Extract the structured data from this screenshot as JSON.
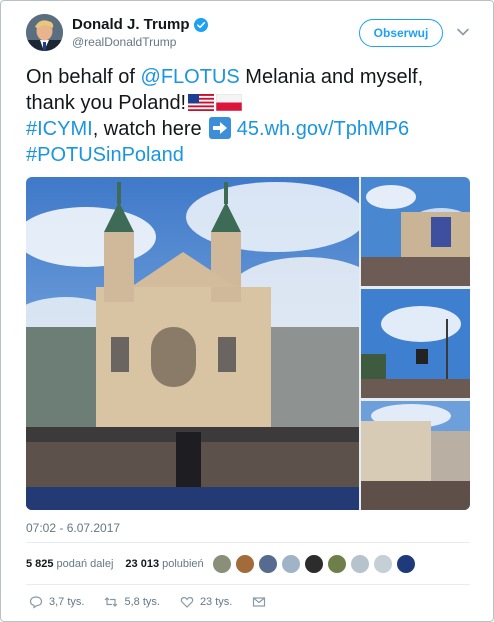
{
  "author": {
    "name": "Donald J. Trump",
    "handle": "@realDonaldTrump"
  },
  "follow_button": "Obserwuj",
  "tweet": {
    "line1_pre": "On behalf of ",
    "mention": "@FLOTUS",
    "line1_post": " Melania and myself,",
    "line2": "thank you Poland!",
    "hashtag1": "#ICYMI",
    "line3_mid": ", watch here",
    "link": "45.wh.gov/TphMP6",
    "hashtag2": "#POTUSinPoland"
  },
  "timestamp": "07:02 - 6.07.2017",
  "stats": {
    "retweets_count": "5 825",
    "retweets_label": "podań dalej",
    "likes_count": "23 013",
    "likes_label": "polubień"
  },
  "actions": {
    "replies": "3,7 tys.",
    "retweets": "5,8 tys.",
    "likes": "23 tys."
  },
  "colors": {
    "accent": "#1da1f2",
    "link": "#1b95e0",
    "muted": "#657786"
  }
}
